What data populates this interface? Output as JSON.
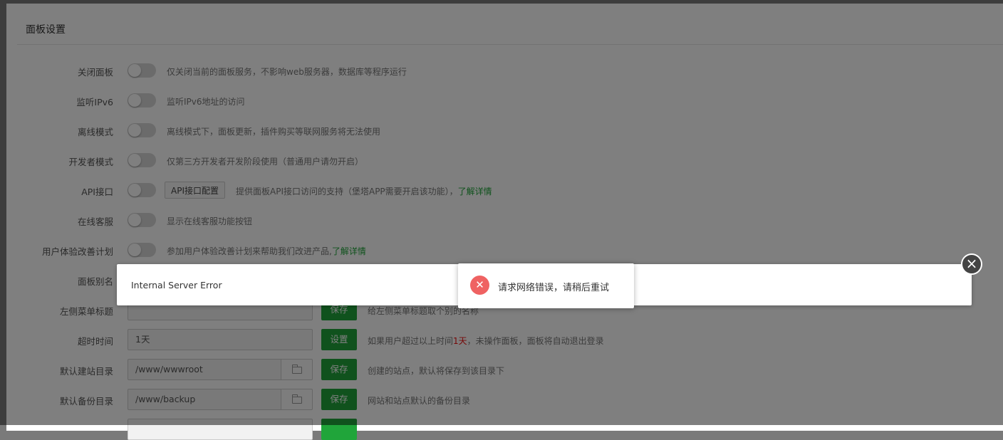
{
  "panel": {
    "title": "面板设置"
  },
  "toggle_rows": [
    {
      "label": "关闭面板",
      "desc": "仅关闭当前的面板服务，不影响web服务器，数据库等程序运行"
    },
    {
      "label": "监听IPv6",
      "desc": "监听IPv6地址的访问"
    },
    {
      "label": "离线模式",
      "desc": "离线模式下，面板更新，插件购买等联网服务将无法使用"
    },
    {
      "label": "开发者模式",
      "desc": "仅第三方开发者开发阶段使用（普通用户请勿开启）"
    },
    {
      "label": "API接口",
      "button": "API接口配置",
      "desc": "提供面板API接口访问的支持（堡塔APP需要开启该功能），",
      "link": "了解详情"
    },
    {
      "label": "在线客服",
      "desc": "显示在线客服功能按钮"
    },
    {
      "label": "用户体验改善计划",
      "desc": "参加用户体验改善计划来帮助我们改进产品,",
      "link": "了解详情"
    }
  ],
  "panel_alias": {
    "label": "面板别名"
  },
  "menu_title": {
    "label": "左侧菜单标题",
    "value": "",
    "button": "保存",
    "desc": "给左侧菜单标题取个别的名称"
  },
  "timeout": {
    "label": "超时时间",
    "value": "1天",
    "button": "设置",
    "desc_before": "如果用户超过以上时间",
    "desc_highlight": "1天",
    "desc_after": "，未操作面板，面板将自动退出登录"
  },
  "site_dir": {
    "label": "默认建站目录",
    "value": "/www/wwwroot",
    "button": "保存",
    "desc": "创建的站点，默认将保存到该目录下"
  },
  "backup_dir": {
    "label": "默认备份目录",
    "value": "/www/backup",
    "button": "保存",
    "desc": "网站和站点默认的备份目录"
  },
  "modal": {
    "message": "Internal Server Error",
    "close_icon": "×"
  },
  "toast": {
    "icon": "✕",
    "message": "请求网络错误，请稍后重试"
  },
  "colors": {
    "accent": "#20a53a",
    "error": "#ef6262"
  }
}
